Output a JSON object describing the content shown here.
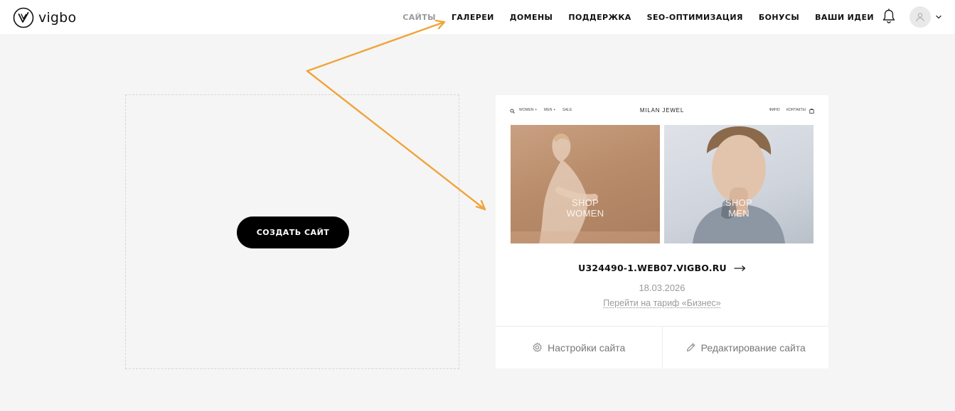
{
  "brand": {
    "name": "vigbo"
  },
  "nav": {
    "items": [
      {
        "label": "САЙТЫ",
        "active": true
      },
      {
        "label": "ГАЛЕРЕИ",
        "active": false
      },
      {
        "label": "ДОМЕНЫ",
        "active": false
      },
      {
        "label": "ПОДДЕРЖКА",
        "active": false
      },
      {
        "label": "SEO-ОПТИМИЗАЦИЯ",
        "active": false
      },
      {
        "label": "БОНУСЫ",
        "active": false
      },
      {
        "label": "ВАШИ ИДЕИ",
        "active": false
      }
    ]
  },
  "header_icons": [
    "bell-icon",
    "user-icon",
    "chevron-down-icon"
  ],
  "create": {
    "button_label": "СОЗДАТЬ САЙТ"
  },
  "site_card": {
    "preview": {
      "nav_left": [
        "WOMEN +",
        "MEN +",
        "SALE"
      ],
      "title": "MILAN JEWEL",
      "nav_right": [
        "ФИНО",
        "КОНТАКТЫ"
      ],
      "tiles": [
        {
          "caption_line1": "SHOP",
          "caption_line2": "WOMEN"
        },
        {
          "caption_line1": "SHOP",
          "caption_line2": "MEN"
        }
      ]
    },
    "domain": "U324490-1.WEB07.VIGBO.RU",
    "date": "18.03.2026",
    "upgrade_link": "Перейти на тариф «Бизнес»",
    "actions": {
      "settings_label": "Настройки сайта",
      "edit_label": "Редактирование сайта"
    }
  },
  "colors": {
    "background": "#f5f5f5",
    "accent_annotation": "#f0a43a",
    "button": "#000000",
    "muted_text": "#9a9a9a"
  }
}
